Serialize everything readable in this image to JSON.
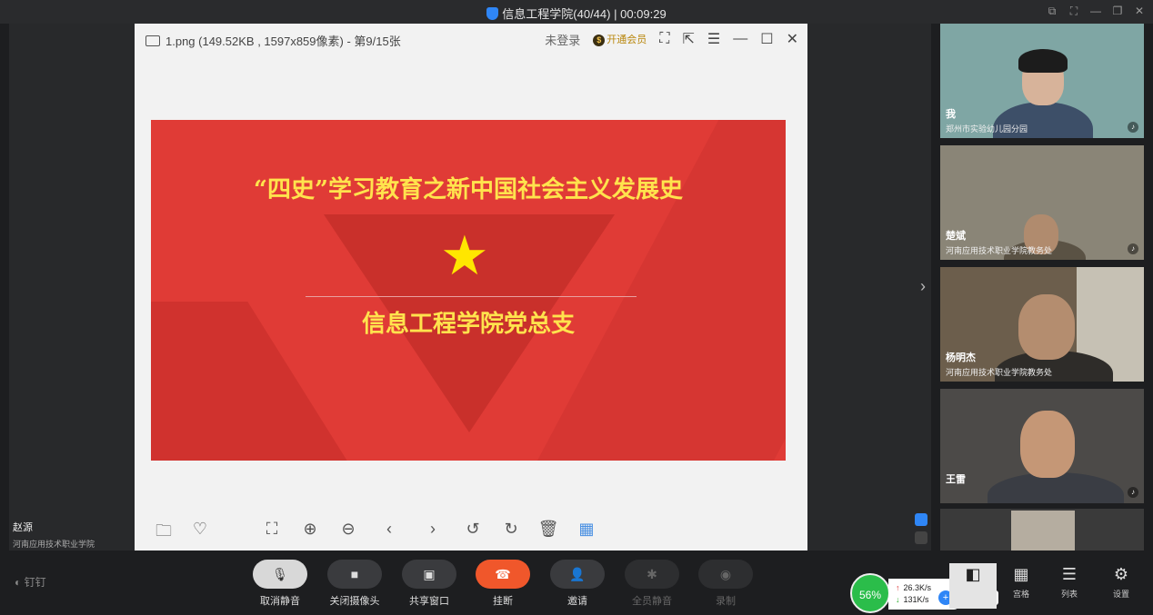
{
  "meeting": {
    "title": "信息工程学院(40/44)",
    "timer": "00:09:29"
  },
  "viewer": {
    "file_info": "1.png (149.52KB , 1597x859像素) - 第9/15张",
    "login": "未登录",
    "vip": "开通会员",
    "slide_title": "“四史”学习教育之新中国社会主义发展史",
    "slide_subtitle": "信息工程学院党总支"
  },
  "speaker": {
    "name": "赵源",
    "org": "河南应用技术职业学院"
  },
  "participants": [
    {
      "name": "我",
      "org": "郑州市实验幼儿园分园"
    },
    {
      "name": "楚斌",
      "org": "河南应用技术职业学院教务处"
    },
    {
      "name": "杨明杰",
      "org": "河南应用技术职业学院教务处"
    },
    {
      "name": "王雷",
      "org": ""
    }
  ],
  "toolbar": {
    "unmute": "取消静音",
    "camera_off": "关闭摄像头",
    "share": "共享窗口",
    "hangup": "挂断",
    "invite": "邀请",
    "mute_all": "全员静音",
    "record": "录制"
  },
  "network": {
    "quality": "56%",
    "up": "26.3K/s",
    "down": "131K/s"
  },
  "views": {
    "grid": "宫格",
    "list": "列表",
    "settings": "设置"
  },
  "brand": "钉钉"
}
